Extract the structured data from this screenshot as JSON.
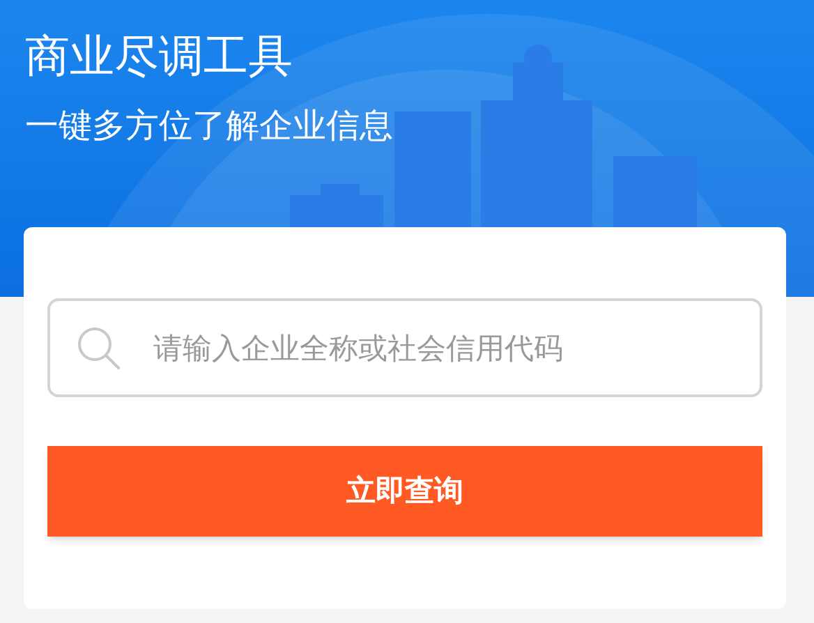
{
  "header": {
    "title": "商业尽调工具",
    "subtitle": "一键多方位了解企业信息"
  },
  "search": {
    "placeholder": "请输入企业全称或社会信用代码"
  },
  "button": {
    "label": "立即查询"
  }
}
